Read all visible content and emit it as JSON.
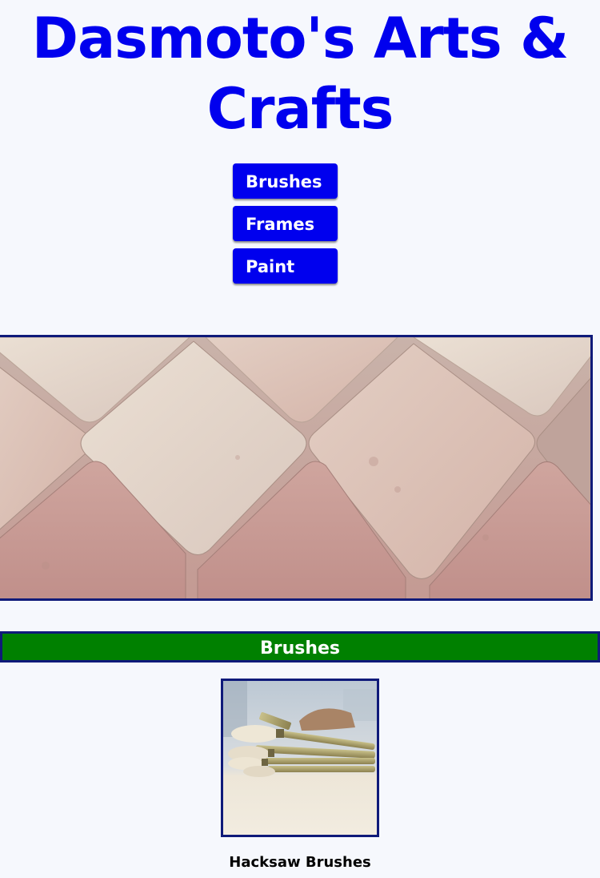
{
  "header": {
    "title": "Dasmoto's Arts & Crafts"
  },
  "nav": {
    "items": [
      {
        "label": "Brushes"
      },
      {
        "label": "Frames"
      },
      {
        "label": "Paint"
      }
    ]
  },
  "hero": {
    "image": "pastel-roof-tiles-image"
  },
  "sections": [
    {
      "heading": "Brushes",
      "products": [
        {
          "name": "Hacksaw Brushes",
          "image": "brushes-image"
        }
      ]
    }
  ],
  "colors": {
    "title": "#0000ee",
    "nav_button": "#0000ee",
    "section_banner": "#008000",
    "border": "#0f1a7a",
    "page_background": "#f6f8fd"
  }
}
